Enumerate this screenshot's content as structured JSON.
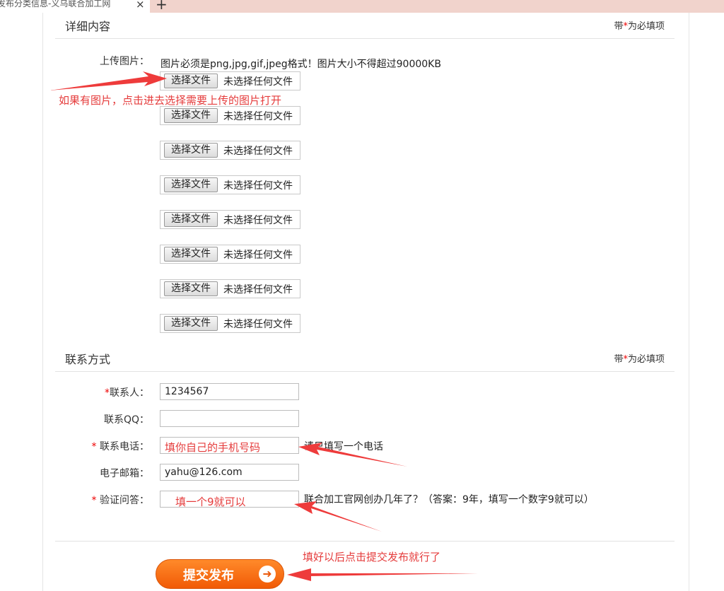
{
  "browser": {
    "tab_title": "发布分类信息-义乌联合加工网",
    "close_glyph": "×",
    "new_tab_glyph": "+"
  },
  "details_section": {
    "title": "详细内容",
    "note_prefix": "带",
    "note_star": "*",
    "note_suffix": "为必填项"
  },
  "upload": {
    "label": "上传图片：",
    "hint": "图片必须是png,jpg,gif,jpeg格式！图片大小不得超过90000KB",
    "files": [
      {
        "button": "选择文件",
        "status": "未选择任何文件"
      },
      {
        "button": "选择文件",
        "status": "未选择任何文件"
      },
      {
        "button": "选择文件",
        "status": "未选择任何文件"
      },
      {
        "button": "选择文件",
        "status": "未选择任何文件"
      },
      {
        "button": "选择文件",
        "status": "未选择任何文件"
      },
      {
        "button": "选择文件",
        "status": "未选择任何文件"
      },
      {
        "button": "选择文件",
        "status": "未选择任何文件"
      },
      {
        "button": "选择文件",
        "status": "未选择任何文件"
      }
    ]
  },
  "contact_section": {
    "title": "联系方式",
    "note_prefix": "带",
    "note_star": "*",
    "note_suffix": "为必填项"
  },
  "contact": {
    "person": {
      "star": "*",
      "label": "联系人：",
      "value": "1234567"
    },
    "qq": {
      "label": "联系QQ：",
      "value": ""
    },
    "phone": {
      "star": "* ",
      "label": "联系电话：",
      "value": "",
      "aside": "请只填写一个电话"
    },
    "email": {
      "label": "电子邮箱：",
      "value": "yahu@126.com"
    },
    "captcha": {
      "star": "* ",
      "label": "验证问答：",
      "value": "",
      "aside": "联合加工官网创办几年了？（答案：9年，填写一个数字9就可以）"
    }
  },
  "annotations": {
    "upload_tip": "如果有图片，点击进去选择需要上传的图片打开",
    "phone_tip": "填你自己的手机号码",
    "captcha_tip": "填一个9就可以",
    "submit_tip": "填好以后点击提交发布就行了"
  },
  "submit": {
    "label": "提交发布",
    "icon_glyph": "➜"
  },
  "colors": {
    "required": "#ee0000",
    "annotation": "#e53c3c",
    "submit": "#f15a06"
  }
}
